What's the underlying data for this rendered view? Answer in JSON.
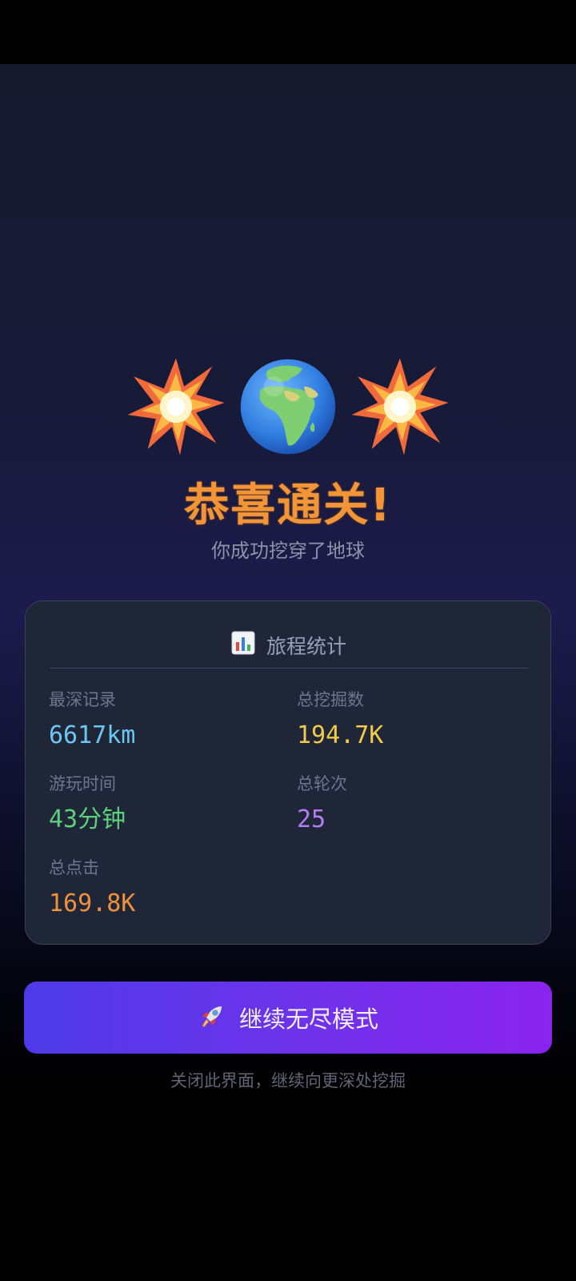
{
  "header": {
    "emojis": [
      "collision-icon",
      "globe-europe-africa-icon",
      "collision-icon"
    ],
    "title": "恭喜通关!",
    "subtitle": "你成功挖穿了地球"
  },
  "stats_card": {
    "icon": "bar-chart-icon",
    "title": "旅程统计",
    "items": [
      {
        "label": "最深记录",
        "value": "6617km",
        "color": "#6cc8f2"
      },
      {
        "label": "总挖掘数",
        "value": "194.7K",
        "color": "#f2cb4a"
      },
      {
        "label": "游玩时间",
        "value": "43分钟",
        "color": "#5ed07c"
      },
      {
        "label": "总轮次",
        "value": "25",
        "color": "#b57ef0"
      },
      {
        "label": "总点击",
        "value": "169.8K",
        "color": "#f0913c"
      }
    ]
  },
  "continue_button": {
    "icon": "rocket-icon",
    "label": "继续无尽模式"
  },
  "hint": "关闭此界面，继续向更深处挖掘",
  "colors": {
    "title": "#f19538",
    "button_start": "#4d3ae8",
    "button_end": "#8a23ee",
    "card_bg": "#1f2638"
  }
}
